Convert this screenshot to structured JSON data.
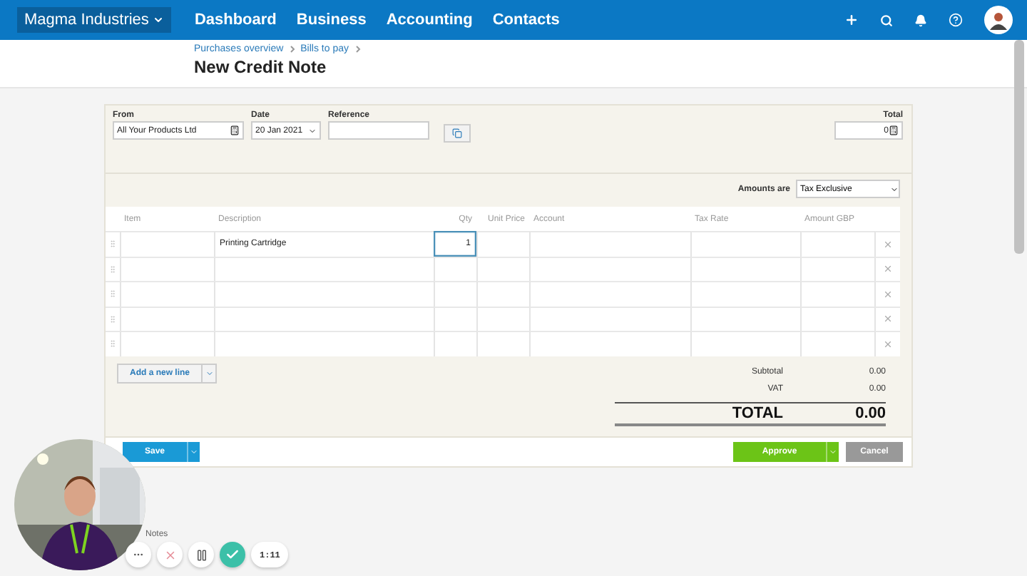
{
  "nav": {
    "org": "Magma Industries",
    "links": [
      "Dashboard",
      "Business",
      "Accounting",
      "Contacts"
    ]
  },
  "breadcrumbs": [
    "Purchases overview",
    "Bills to pay"
  ],
  "title": "New Credit Note",
  "form": {
    "from": {
      "label": "From",
      "value": "All Your Products Ltd"
    },
    "date": {
      "label": "Date",
      "value": "20 Jan 2021"
    },
    "reference": {
      "label": "Reference"
    },
    "total": {
      "label": "Total",
      "value": "0"
    }
  },
  "amounts_are": {
    "label": "Amounts are",
    "value": "Tax Exclusive"
  },
  "columns": [
    "Item",
    "Description",
    "Qty",
    "Unit Price",
    "Account",
    "Tax Rate",
    "Amount GBP"
  ],
  "rows": [
    {
      "description": "Printing Cartridge",
      "qty": "1",
      "focused": true
    },
    {
      "focused": false
    },
    {
      "focused": false
    },
    {
      "focused": false
    },
    {
      "focused": false
    }
  ],
  "add_line": "Add a new line",
  "totals": [
    {
      "label": "Subtotal",
      "value": "0.00"
    },
    {
      "label": "VAT",
      "value": "0.00"
    }
  ],
  "grand_total": {
    "label": "TOTAL",
    "value": "0.00"
  },
  "actions": {
    "save": "Save",
    "approve": "Approve",
    "cancel": "Cancel"
  },
  "notes": "Notes",
  "recorder": {
    "timer": "1:11"
  }
}
